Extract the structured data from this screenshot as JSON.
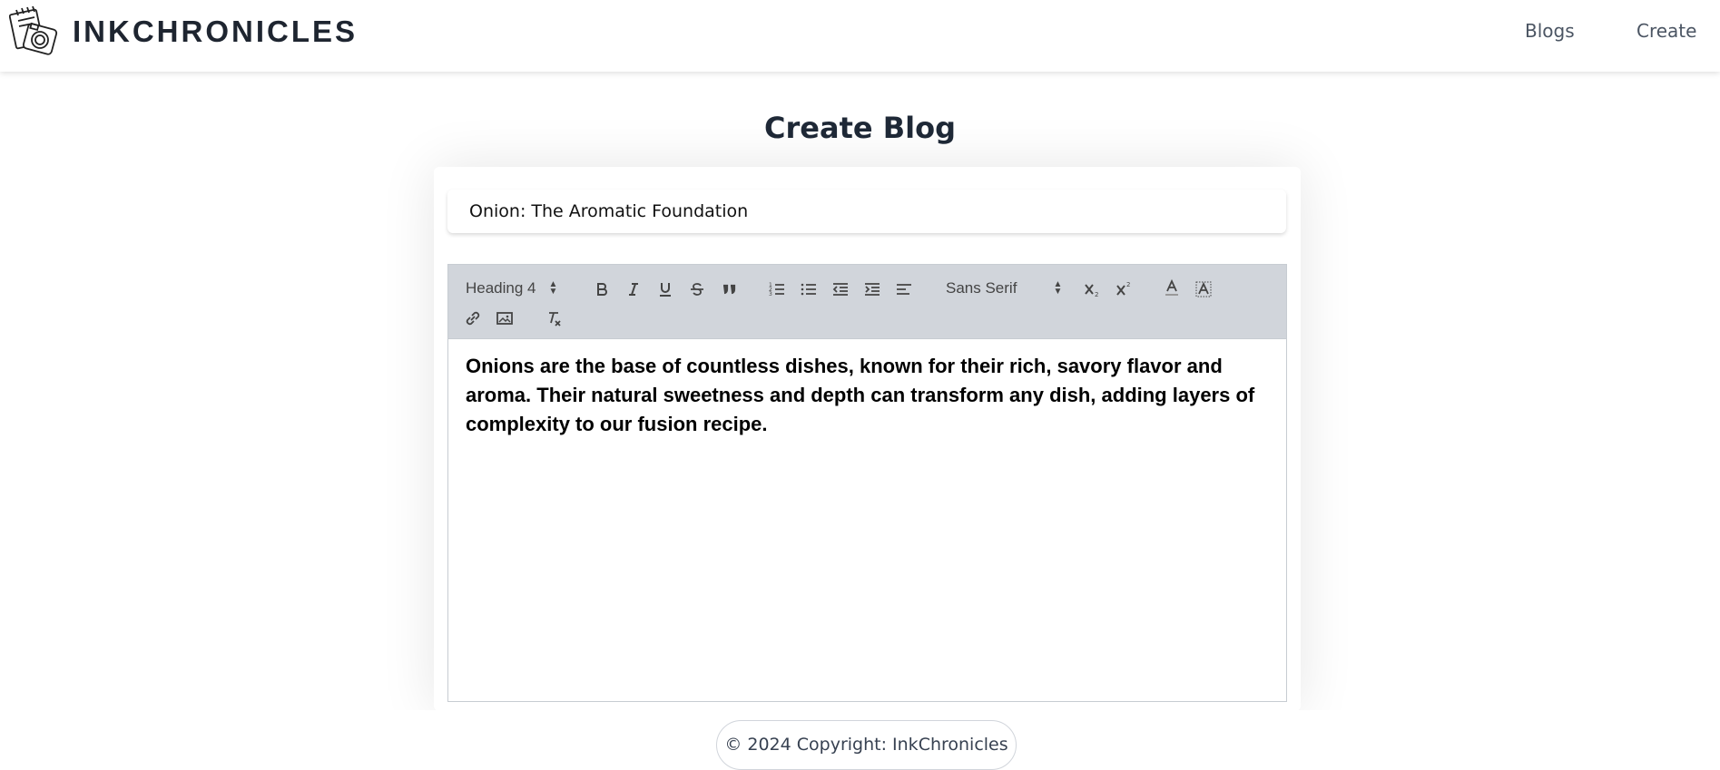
{
  "header": {
    "brand_name": "INKCHRONICLES",
    "logo_icon": "camera-notebook-logo",
    "nav": [
      {
        "label": "Blogs"
      },
      {
        "label": "Create"
      }
    ]
  },
  "page": {
    "title": "Create Blog"
  },
  "form": {
    "title_value": "Onion: The Aromatic Foundation",
    "toolbar": {
      "header_picker": "Heading 4",
      "font_picker": "Sans Serif",
      "buttons": [
        "bold",
        "italic",
        "underline",
        "strike",
        "blockquote",
        "ordered-list",
        "bullet-list",
        "indent-decrease",
        "indent-increase",
        "align",
        "subscript",
        "superscript",
        "text-color",
        "background-color",
        "link",
        "image",
        "clear-formatting"
      ]
    },
    "content": "Onions are the base of countless dishes, known for their rich, savory flavor and aroma. Their natural sweetness and depth can transform any dish, adding layers of complexity to our fusion recipe."
  },
  "footer": {
    "copyright": "© 2024 Copyright: InkChronicles"
  },
  "colors": {
    "toolbar_bg": "#d1d5db",
    "text_dark": "#1f2937",
    "nav_text": "#4b5563"
  }
}
